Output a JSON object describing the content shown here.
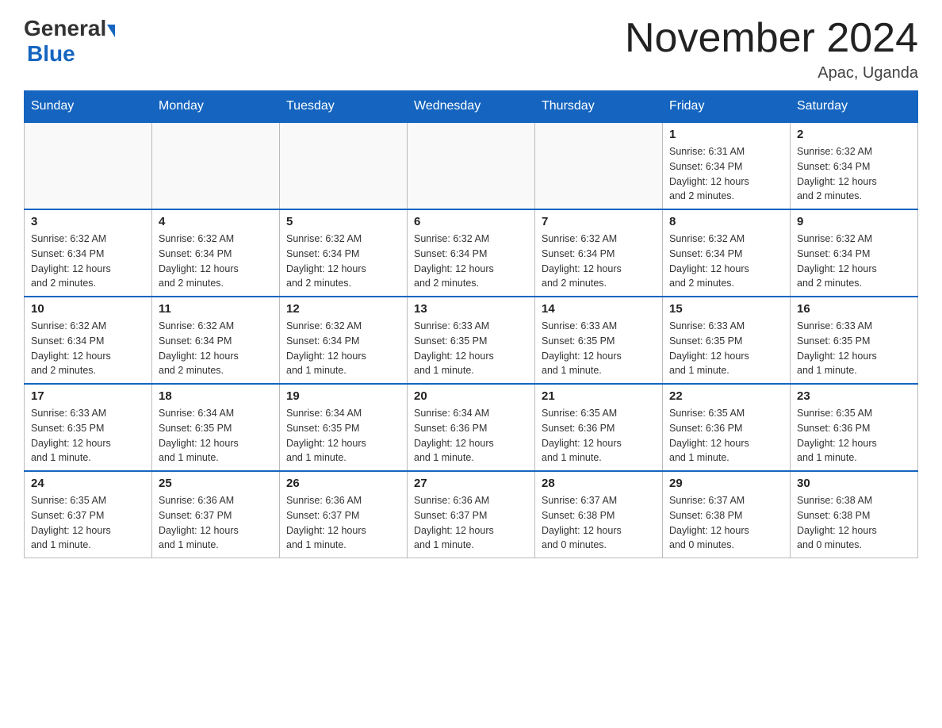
{
  "header": {
    "logo_general": "General",
    "logo_blue": "Blue",
    "month_title": "November 2024",
    "location": "Apac, Uganda"
  },
  "days_of_week": [
    "Sunday",
    "Monday",
    "Tuesday",
    "Wednesday",
    "Thursday",
    "Friday",
    "Saturday"
  ],
  "weeks": [
    [
      {
        "day": "",
        "info": ""
      },
      {
        "day": "",
        "info": ""
      },
      {
        "day": "",
        "info": ""
      },
      {
        "day": "",
        "info": ""
      },
      {
        "day": "",
        "info": ""
      },
      {
        "day": "1",
        "info": "Sunrise: 6:31 AM\nSunset: 6:34 PM\nDaylight: 12 hours\nand 2 minutes."
      },
      {
        "day": "2",
        "info": "Sunrise: 6:32 AM\nSunset: 6:34 PM\nDaylight: 12 hours\nand 2 minutes."
      }
    ],
    [
      {
        "day": "3",
        "info": "Sunrise: 6:32 AM\nSunset: 6:34 PM\nDaylight: 12 hours\nand 2 minutes."
      },
      {
        "day": "4",
        "info": "Sunrise: 6:32 AM\nSunset: 6:34 PM\nDaylight: 12 hours\nand 2 minutes."
      },
      {
        "day": "5",
        "info": "Sunrise: 6:32 AM\nSunset: 6:34 PM\nDaylight: 12 hours\nand 2 minutes."
      },
      {
        "day": "6",
        "info": "Sunrise: 6:32 AM\nSunset: 6:34 PM\nDaylight: 12 hours\nand 2 minutes."
      },
      {
        "day": "7",
        "info": "Sunrise: 6:32 AM\nSunset: 6:34 PM\nDaylight: 12 hours\nand 2 minutes."
      },
      {
        "day": "8",
        "info": "Sunrise: 6:32 AM\nSunset: 6:34 PM\nDaylight: 12 hours\nand 2 minutes."
      },
      {
        "day": "9",
        "info": "Sunrise: 6:32 AM\nSunset: 6:34 PM\nDaylight: 12 hours\nand 2 minutes."
      }
    ],
    [
      {
        "day": "10",
        "info": "Sunrise: 6:32 AM\nSunset: 6:34 PM\nDaylight: 12 hours\nand 2 minutes."
      },
      {
        "day": "11",
        "info": "Sunrise: 6:32 AM\nSunset: 6:34 PM\nDaylight: 12 hours\nand 2 minutes."
      },
      {
        "day": "12",
        "info": "Sunrise: 6:32 AM\nSunset: 6:34 PM\nDaylight: 12 hours\nand 1 minute."
      },
      {
        "day": "13",
        "info": "Sunrise: 6:33 AM\nSunset: 6:35 PM\nDaylight: 12 hours\nand 1 minute."
      },
      {
        "day": "14",
        "info": "Sunrise: 6:33 AM\nSunset: 6:35 PM\nDaylight: 12 hours\nand 1 minute."
      },
      {
        "day": "15",
        "info": "Sunrise: 6:33 AM\nSunset: 6:35 PM\nDaylight: 12 hours\nand 1 minute."
      },
      {
        "day": "16",
        "info": "Sunrise: 6:33 AM\nSunset: 6:35 PM\nDaylight: 12 hours\nand 1 minute."
      }
    ],
    [
      {
        "day": "17",
        "info": "Sunrise: 6:33 AM\nSunset: 6:35 PM\nDaylight: 12 hours\nand 1 minute."
      },
      {
        "day": "18",
        "info": "Sunrise: 6:34 AM\nSunset: 6:35 PM\nDaylight: 12 hours\nand 1 minute."
      },
      {
        "day": "19",
        "info": "Sunrise: 6:34 AM\nSunset: 6:35 PM\nDaylight: 12 hours\nand 1 minute."
      },
      {
        "day": "20",
        "info": "Sunrise: 6:34 AM\nSunset: 6:36 PM\nDaylight: 12 hours\nand 1 minute."
      },
      {
        "day": "21",
        "info": "Sunrise: 6:35 AM\nSunset: 6:36 PM\nDaylight: 12 hours\nand 1 minute."
      },
      {
        "day": "22",
        "info": "Sunrise: 6:35 AM\nSunset: 6:36 PM\nDaylight: 12 hours\nand 1 minute."
      },
      {
        "day": "23",
        "info": "Sunrise: 6:35 AM\nSunset: 6:36 PM\nDaylight: 12 hours\nand 1 minute."
      }
    ],
    [
      {
        "day": "24",
        "info": "Sunrise: 6:35 AM\nSunset: 6:37 PM\nDaylight: 12 hours\nand 1 minute."
      },
      {
        "day": "25",
        "info": "Sunrise: 6:36 AM\nSunset: 6:37 PM\nDaylight: 12 hours\nand 1 minute."
      },
      {
        "day": "26",
        "info": "Sunrise: 6:36 AM\nSunset: 6:37 PM\nDaylight: 12 hours\nand 1 minute."
      },
      {
        "day": "27",
        "info": "Sunrise: 6:36 AM\nSunset: 6:37 PM\nDaylight: 12 hours\nand 1 minute."
      },
      {
        "day": "28",
        "info": "Sunrise: 6:37 AM\nSunset: 6:38 PM\nDaylight: 12 hours\nand 0 minutes."
      },
      {
        "day": "29",
        "info": "Sunrise: 6:37 AM\nSunset: 6:38 PM\nDaylight: 12 hours\nand 0 minutes."
      },
      {
        "day": "30",
        "info": "Sunrise: 6:38 AM\nSunset: 6:38 PM\nDaylight: 12 hours\nand 0 minutes."
      }
    ]
  ]
}
